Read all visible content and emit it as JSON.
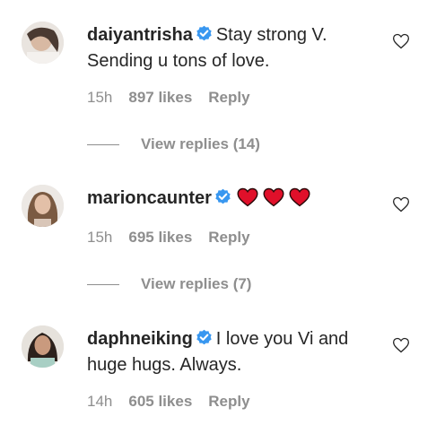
{
  "comments": [
    {
      "username": "daiyantrisha",
      "text_line1": "Stay strong V.",
      "text_line2": "Sending u tons of love.",
      "time": "15h",
      "likes": "897 likes",
      "reply": "Reply",
      "view_replies": "View replies (14)",
      "avatar_icon": "avatar-photo"
    },
    {
      "username": "marioncaunter",
      "hearts": [
        "heart-emoji",
        "heart-emoji",
        "heart-emoji"
      ],
      "time": "15h",
      "likes": "695 likes",
      "reply": "Reply",
      "view_replies": "View replies (7)",
      "avatar_icon": "avatar-photo"
    },
    {
      "username": "daphneiking",
      "text_line1": "I love you Vi and",
      "text_line2": "huge hugs. Always.",
      "time": "14h",
      "likes": "605 likes",
      "reply": "Reply",
      "avatar_icon": "avatar-photo"
    }
  ],
  "colors": {
    "verified": "#3897f0",
    "heart": "#e0102a",
    "muted": "#8e8e8e",
    "text": "#262626"
  }
}
